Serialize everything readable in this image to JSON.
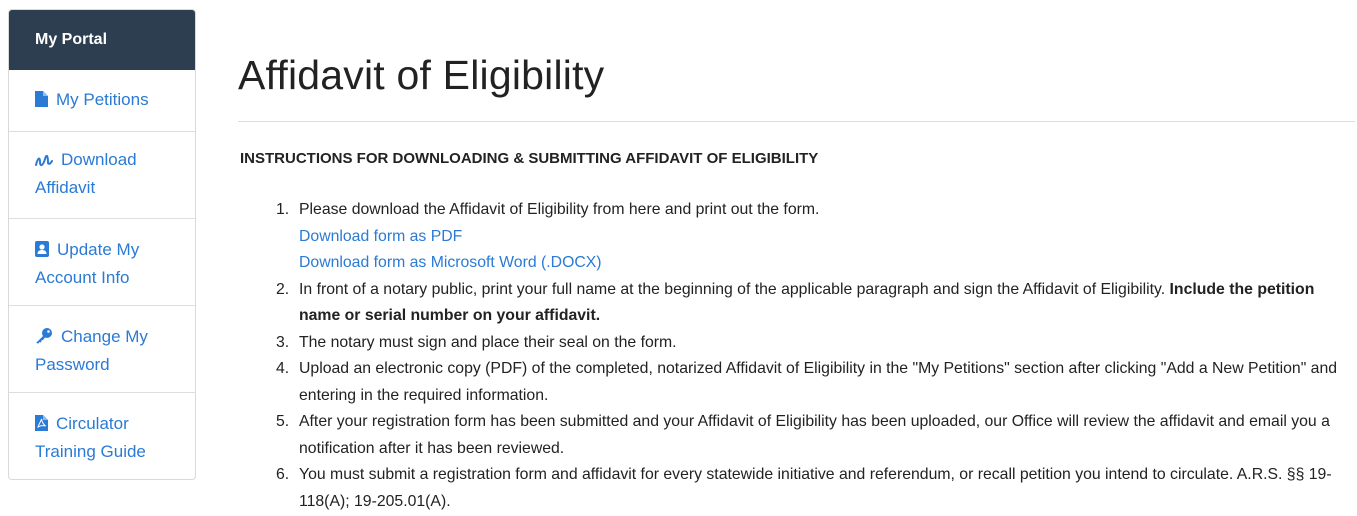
{
  "sidebar": {
    "header": "My Portal",
    "items": [
      {
        "label": "My Petitions",
        "icon": "document-icon"
      },
      {
        "label": "Download Affidavit",
        "icon": "signature-icon"
      },
      {
        "label": "Update My Account Info",
        "icon": "contact-card-icon"
      },
      {
        "label": "Change My Password",
        "icon": "key-icon"
      },
      {
        "label": "Circulator Training Guide",
        "icon": "pdf-file-icon"
      }
    ]
  },
  "main": {
    "title": "Affidavit of Eligibility",
    "instructions_heading": "INSTRUCTIONS FOR DOWNLOADING & SUBMITTING AFFIDAVIT OF ELIGIBILITY",
    "steps": [
      {
        "number": "1.",
        "text": "Please download the Affidavit of Eligibility from here and print out the form.",
        "links": [
          "Download form as PDF",
          "Download form as Microsoft Word (.DOCX)"
        ]
      },
      {
        "number": "2.",
        "text": "In front of a notary public, print your full name at the beginning of the applicable paragraph and sign the Affidavit of Eligibility.",
        "bold": "Include the petition name or serial number on your affidavit."
      },
      {
        "number": "3.",
        "text": "The notary must sign and place their seal on the form."
      },
      {
        "number": "4.",
        "text": "Upload an electronic copy (PDF) of the completed, notarized Affidavit of Eligibility in the \"My Petitions\" section after clicking \"Add a New Petition\" and entering in the required information."
      },
      {
        "number": "5.",
        "text": "After your registration form has been submitted and your Affidavit of Eligibility has been uploaded, our Office will review the affidavit and email you a notification after it has been reviewed."
      },
      {
        "number": "6.",
        "text": "You must submit a registration form and affidavit for every statewide initiative and referendum, or recall petition you intend to circulate. A.R.S. §§ 19-118(A); 19-205.01(A)."
      }
    ]
  },
  "colors": {
    "sidebar_header_bg": "#2d3e50",
    "link": "#2a7ad6",
    "text": "#222222"
  }
}
